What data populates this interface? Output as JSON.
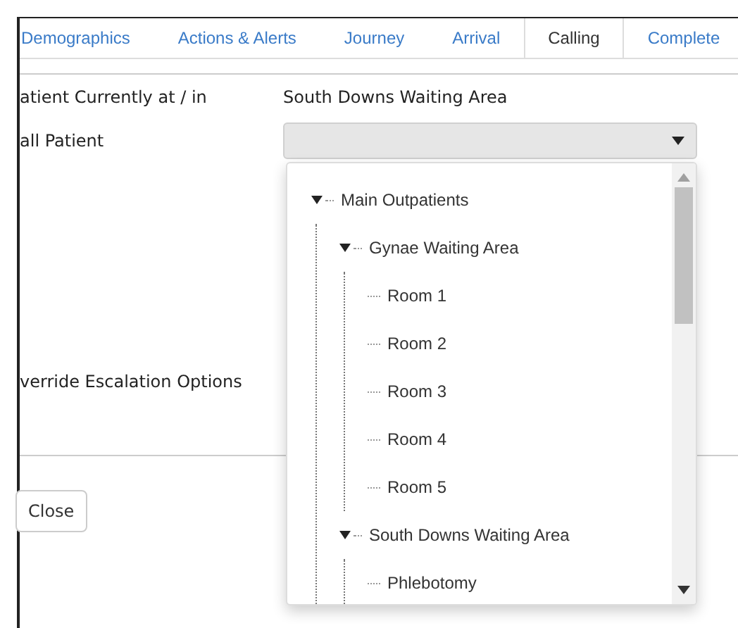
{
  "tabs": [
    {
      "label": "Demographics",
      "selected": false
    },
    {
      "label": "Actions & Alerts",
      "selected": false
    },
    {
      "label": "Journey",
      "selected": false
    },
    {
      "label": "Arrival",
      "selected": false
    },
    {
      "label": "Calling",
      "selected": true
    },
    {
      "label": "Complete",
      "selected": false
    }
  ],
  "fields": [
    {
      "label": "atient Currently at / in",
      "value": "South Downs Waiting Area",
      "kind": "text"
    },
    {
      "label": "all Patient",
      "kind": "select"
    },
    {
      "label": "verride Escalation Options",
      "kind": "empty"
    }
  ],
  "buttons": [
    "Close"
  ],
  "dropdown_tree": [
    {
      "label": "Main Outpatients",
      "expanded": true,
      "children": [
        {
          "label": "Gynae Waiting Area",
          "expanded": true,
          "children": [
            {
              "label": "Room 1"
            },
            {
              "label": "Room 2"
            },
            {
              "label": "Room 3"
            },
            {
              "label": "Room 4"
            },
            {
              "label": "Room 5"
            }
          ]
        },
        {
          "label": "South Downs Waiting Area",
          "expanded": true,
          "children": [
            {
              "label": "Phlebotomy"
            }
          ]
        }
      ]
    }
  ]
}
